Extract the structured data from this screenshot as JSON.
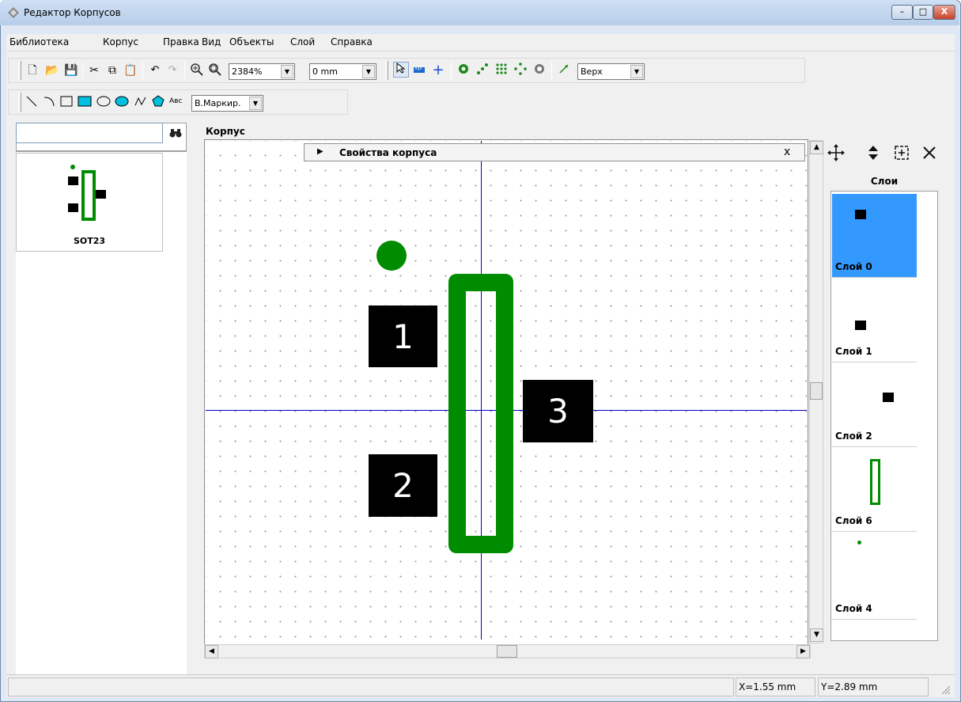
{
  "window": {
    "title": "Редактор Корпусов",
    "minimize_label": "–",
    "maximize_label": "□",
    "close_label": "X"
  },
  "menu": [
    "Библиотека",
    "Корпус",
    "Правка",
    "Вид",
    "Объекты",
    "Слой",
    "Справка"
  ],
  "toolbar": {
    "zoom_value": "2384%",
    "grid_value": "0 mm",
    "side_value": "Верх",
    "text_tool_label": "Авс",
    "draw_layer_value": "В.Маркир."
  },
  "library": {
    "search_value": "",
    "items": [
      {
        "name": "SOT23"
      }
    ]
  },
  "main": {
    "group_label": "Корпус",
    "properties_title": "Свойства корпуса",
    "properties_close": "x"
  },
  "pads": [
    {
      "label": "1"
    },
    {
      "label": "2"
    },
    {
      "label": "3"
    }
  ],
  "layers": {
    "header": "Слои",
    "items": [
      {
        "name": "Слой 0",
        "selected": true
      },
      {
        "name": "Слой 1",
        "selected": false
      },
      {
        "name": "Слой 2",
        "selected": false
      },
      {
        "name": "Слой 6",
        "selected": false
      },
      {
        "name": "Слой 4",
        "selected": false
      }
    ]
  },
  "status": {
    "x_coord": "X=1.55 mm",
    "y_coord": "Y=2.89 mm"
  },
  "colors": {
    "silkscreen": "#008c00",
    "pad": "#000000",
    "crosshair": "#0000c8",
    "selected_layer": "#3399ff"
  }
}
